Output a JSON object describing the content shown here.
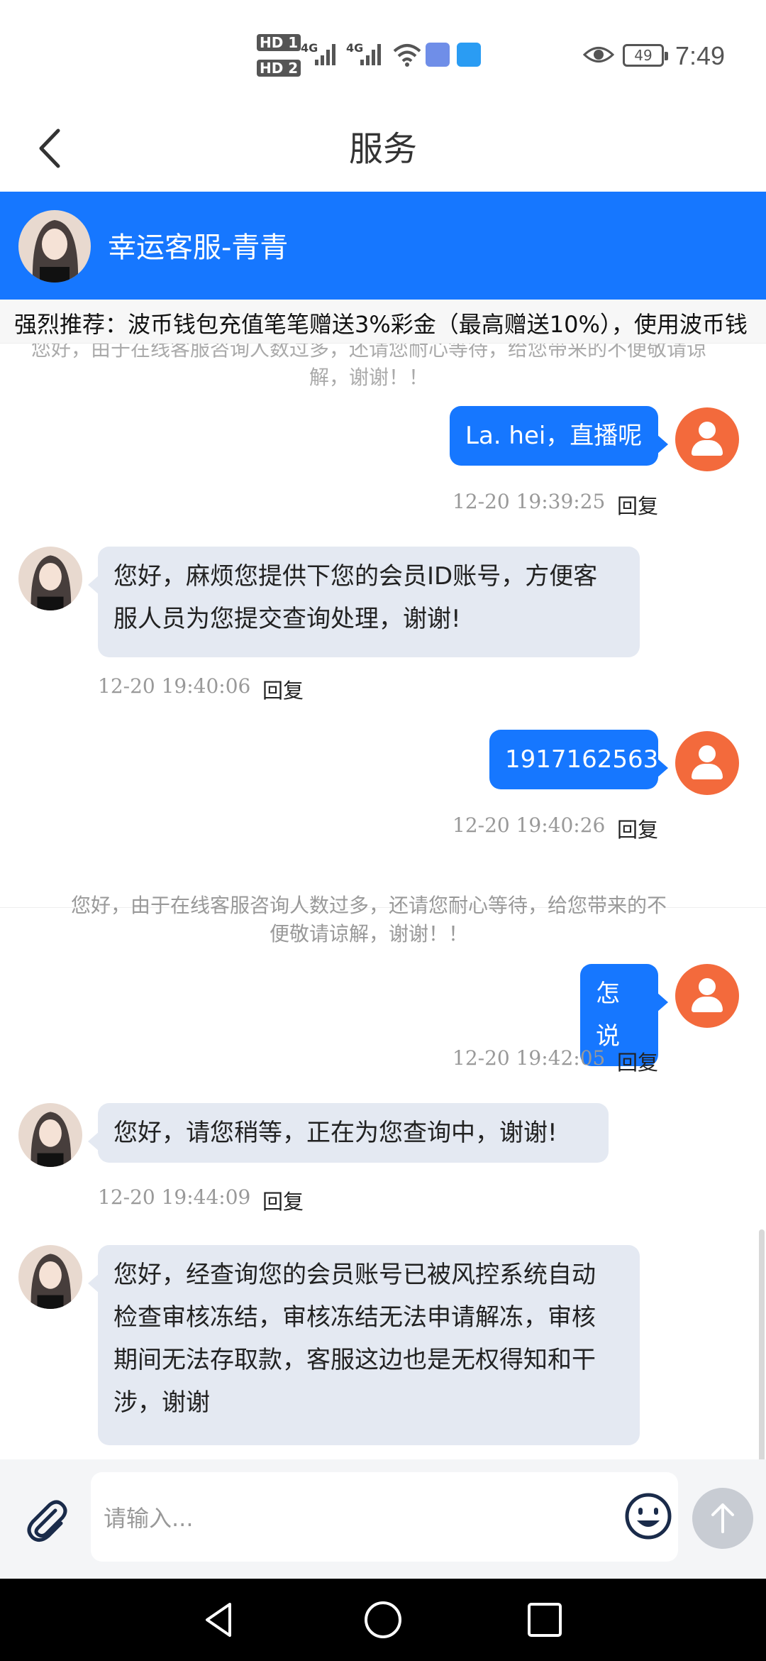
{
  "status_bar": {
    "hd1": "HD 1",
    "hd2": "HD 2",
    "net1": "4G",
    "net2": "4G",
    "battery": "49",
    "time": "7:49"
  },
  "nav": {
    "title": "服务"
  },
  "agent": {
    "name": "幸运客服-青青"
  },
  "marquee": {
    "text": "强烈推荐：波币钱包充值笔笔赠送3%彩金（最高赠送10%），使用波币钱"
  },
  "messages": {
    "sys_top": "您好，由于在线客服咨询人数过多，还请您耐心等待，给您带来的不便敬请谅解，谢谢！！",
    "m1": {
      "text": "La. hei，直播呢",
      "time": "12-20 19:39:25",
      "reply": "回复"
    },
    "m2": {
      "line1": "您好，麻烦您提供下您的会员ID账号，方便客",
      "line2": "服人员为您提交查询处理，谢谢!",
      "time": "12-20 19:40:06",
      "reply": "回复"
    },
    "m3": {
      "text": "1917162563",
      "time": "12-20 19:40:26",
      "reply": "回复"
    },
    "sys_mid_line1": "您好，由于在线客服咨询人数过多，还请您耐心等待，给您带来的不",
    "sys_mid_line2": "便敬请谅解，谢谢！！",
    "m4": {
      "text": "怎说",
      "time": "12-20 19:42:05",
      "reply": "回复"
    },
    "m5": {
      "text": "您好，请您稍等，正在为您查询中，谢谢!",
      "time": "12-20 19:44:09",
      "reply": "回复"
    },
    "m6": {
      "line1": "您好，经查询您的会员账号已被风控系统自动",
      "line2": "检查审核冻结，审核冻结无法申请解冻，审核",
      "line3": "期间无法存取款，客服这边也是无权得知和干",
      "line4": "涉，谢谢"
    }
  },
  "input": {
    "placeholder": "请输入..."
  },
  "colors": {
    "brand_blue": "#1677ff",
    "user_avatar": "#f36a3c",
    "agent_bubble": "#e4e9f2"
  }
}
